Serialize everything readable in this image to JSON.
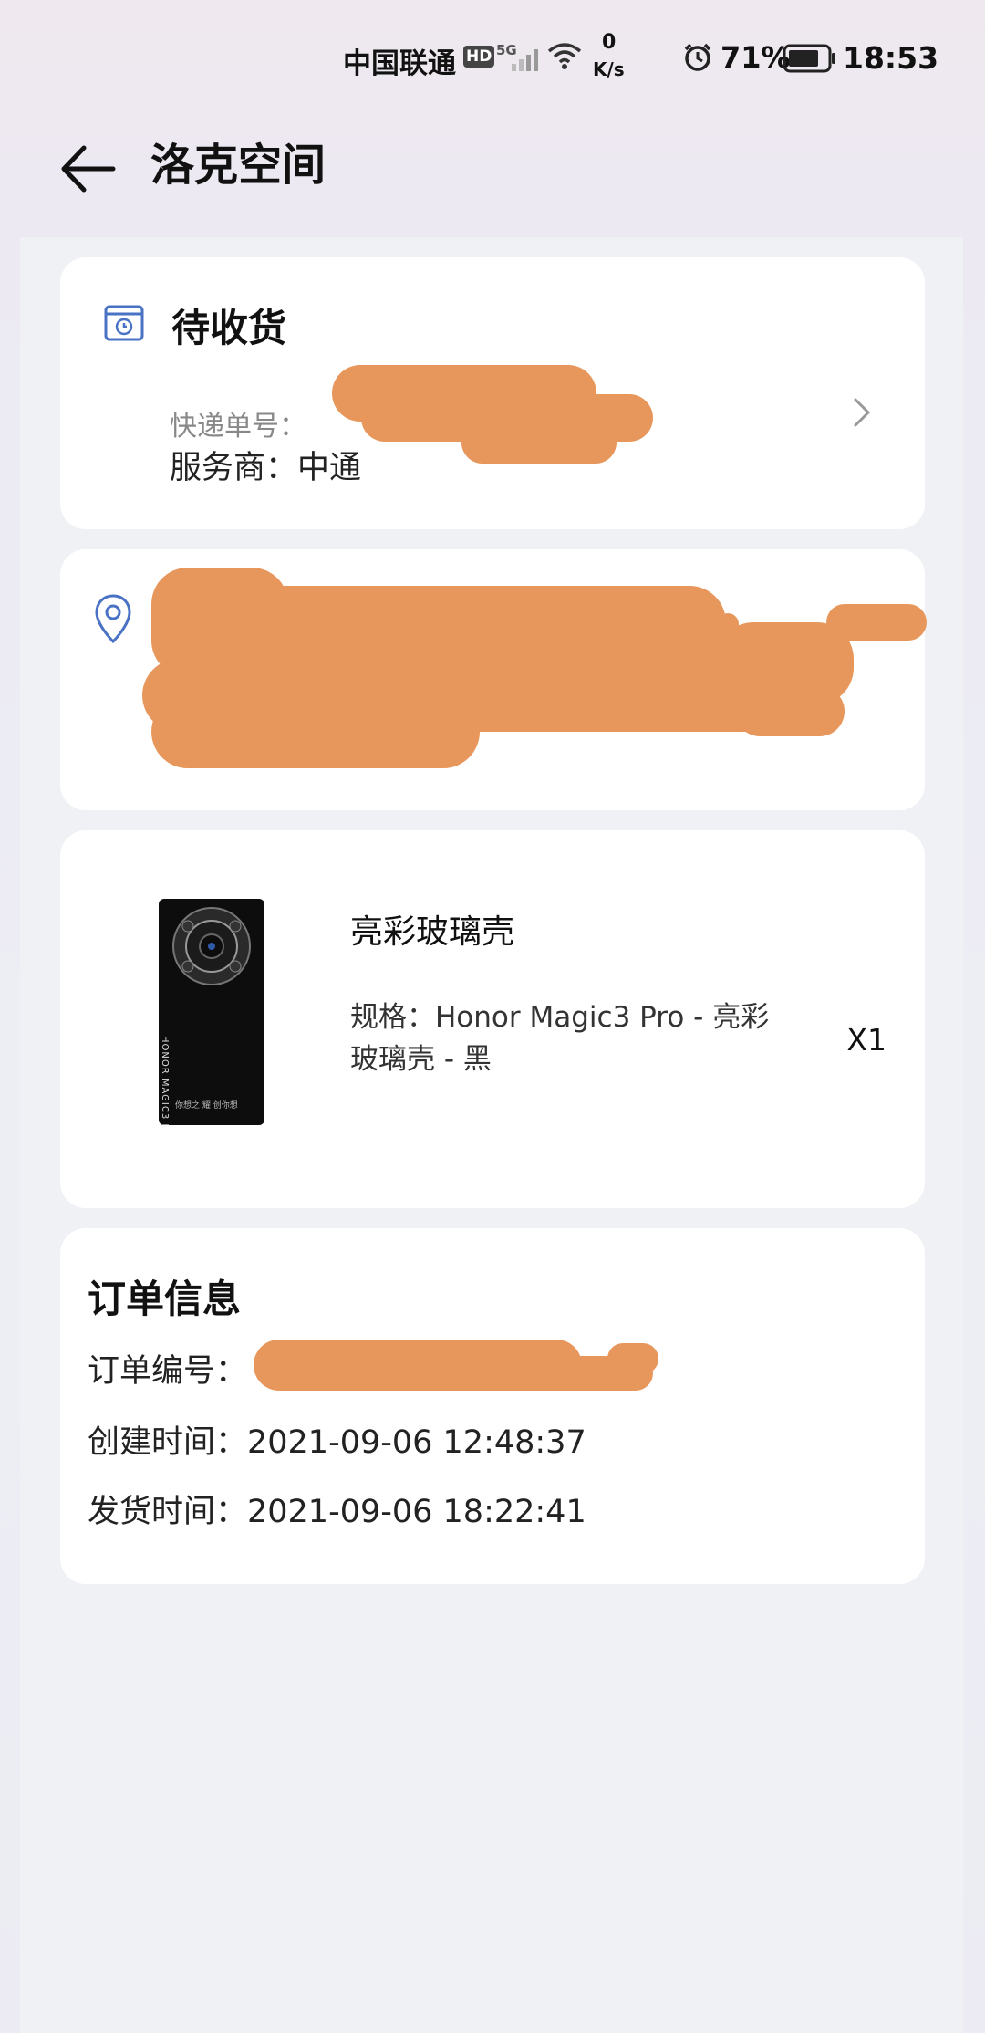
{
  "status_bar": {
    "carrier": "中国联通",
    "hd_badge": "HD",
    "network": "5G",
    "speed_value": "0",
    "speed_unit": "K/s",
    "battery": "71%",
    "time": "18:53",
    "icons": [
      "signal-icon",
      "wifi-icon",
      "alarm-icon",
      "battery-icon"
    ]
  },
  "header": {
    "title": "洛克空间",
    "back_icon": "back-arrow-icon"
  },
  "shipment": {
    "status": "待收货",
    "tracking_label": "快递单号：",
    "provider": "服务商：中通",
    "status_icon": "package-clock-icon",
    "chevron_icon": "chevron-right-icon"
  },
  "address": {
    "location_icon": "location-pin-icon"
  },
  "product": {
    "name": "亮彩玻璃壳",
    "spec": "规格：Honor Magic3 Pro - 亮彩玻璃壳 - 黑",
    "quantity": "X1",
    "thumb_text": "HONOR MAGIC3 PRO",
    "thumb_slogan": "你想之 耀 创你想"
  },
  "order": {
    "title": "订单信息",
    "number_label": "订单编号：",
    "created": "创建时间：2021-09-06 12:48:37",
    "shipped": "发货时间：2021-09-06 18:22:41"
  },
  "colors": {
    "accent_blue": "#4a72c4",
    "redaction_orange": "#e7975b",
    "card_bg": "#ffffff"
  }
}
